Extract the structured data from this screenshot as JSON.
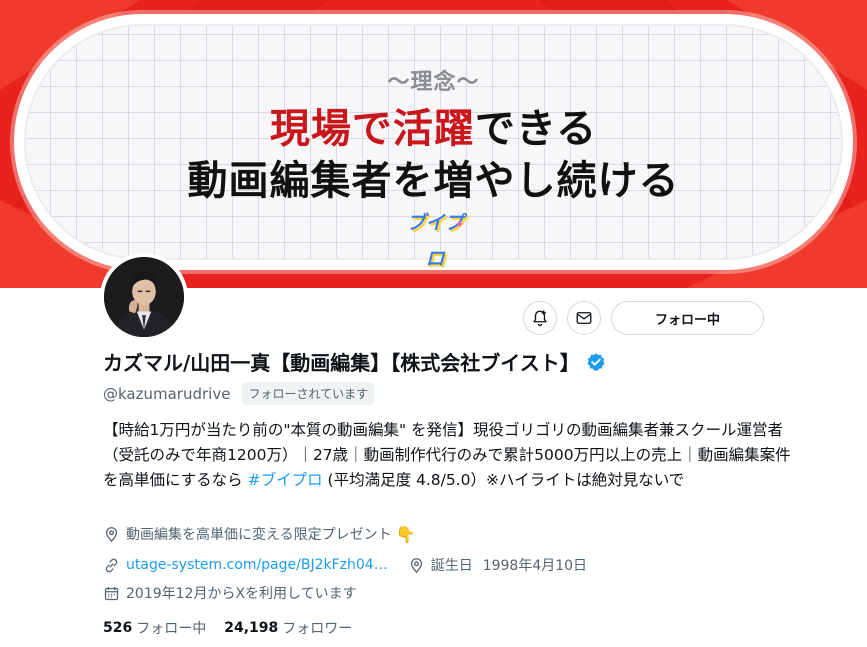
{
  "banner": {
    "motto": "〜理念〜",
    "headline_part1_red": "現場で活躍",
    "headline_part1_rest": "できる",
    "headline_line2": "動画編集者を増やし続ける",
    "logo_text": "ブイプロ",
    "colors": {
      "background": "#e8231d",
      "accent_red": "#c9161a"
    }
  },
  "profile": {
    "display_name": "カズマル/山田一真【動画編集】【株式会社ブイスト】",
    "handle": "@kazumarudrive",
    "follows_you_label": "フォローされています",
    "verified": true,
    "bio_before_tag": "【時給1万円が当たり前の\"本質の動画編集\" を発信】現役ゴリゴリの動画編集者兼スクール運営者（受託のみで年商1200万）｜27歳｜動画制作代行のみで累計5000万円以上の売上｜動画編集案件を高単価にするなら ",
    "bio_hashtag": "#ブイプロ",
    "bio_after_tag": " (平均満足度 4.8/5.0）※ハイライトは絶対見ないで",
    "location": "動画編集を高単価に変える限定プレゼント",
    "location_emoji": "👇",
    "website": "utage-system.com/page/BJ2kFzh04…",
    "birthday_label": "誕生日",
    "birthday_value": "1998年4月10日",
    "joined": "2019年12月からXを利用しています",
    "following_count": "526",
    "following_label": "フォロー中",
    "followers_count": "24,198",
    "followers_label": "フォロワー"
  },
  "actions": {
    "notify_icon": "bell-plus-icon",
    "message_icon": "mail-icon",
    "follow_button_label": "フォロー中"
  },
  "colors": {
    "link": "#1d9bf0",
    "secondary_text": "#536471",
    "primary_text": "#0f1419"
  }
}
